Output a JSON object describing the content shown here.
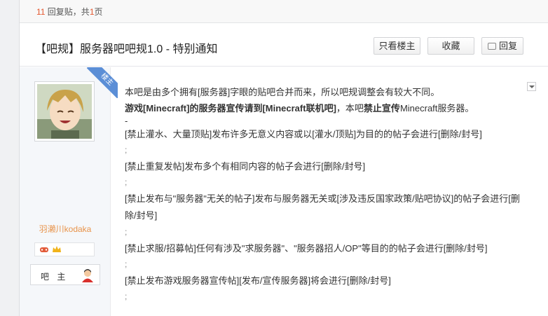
{
  "header": {
    "reply_count": "11",
    "reply_text": " 回复贴，共",
    "page_count": "1",
    "page_text": "页"
  },
  "thread": {
    "title": "【吧规】服务器吧吧规1.0 - 特别通知",
    "btn_host_only": "只看楼主",
    "btn_favorite": "收藏",
    "btn_reply": "回复"
  },
  "author": {
    "username": "羽濑川kodaka",
    "tag": "楼主",
    "role": "吧 主",
    "icons": [
      "game-badge-icon",
      "crown-badge-icon",
      "bar-owner-avatar-icon"
    ]
  },
  "post": {
    "intro": "本吧是由多个拥有[服务器]字眼的贴吧合并而来，所以吧规调整会有较大不同。",
    "l2_bold1": "游戏[Minecraft]的服务器宣传请到[Minecraft联机吧]",
    "l2_plain1": "，本吧",
    "l2_bold2": "禁止宣传",
    "l2_plain2": "Minecraft服务器。",
    "dash": "-",
    "rule1": "[禁止灌水、大量顶贴]发布许多无意义内容或以[灌水/顶贴]为目的的帖子会进行[删除/封号]",
    "rule2": "[禁止重复发帖]发布多个有相同内容的帖子会进行[删除/封号]",
    "rule3": "[禁止发布与\"服务器\"无关的帖子]发布与服务器无关或[涉及违反国家政策/贴吧协议]的帖子会进行[删除/封号]",
    "rule4": "[禁止求服/招募帖]任何有涉及\"求服务器\"、\"服务器招人/OP\"等目的的帖子会进行[删除/封号]",
    "rule5": "[禁止发布游戏服务器宣传帖][发布/宣传服务器]将会进行[删除/封号]",
    "sep": ";"
  },
  "colors": {
    "accent_orange": "#e8934a",
    "count_red": "#e4572e",
    "tag_blue": "#5b8ed6"
  }
}
